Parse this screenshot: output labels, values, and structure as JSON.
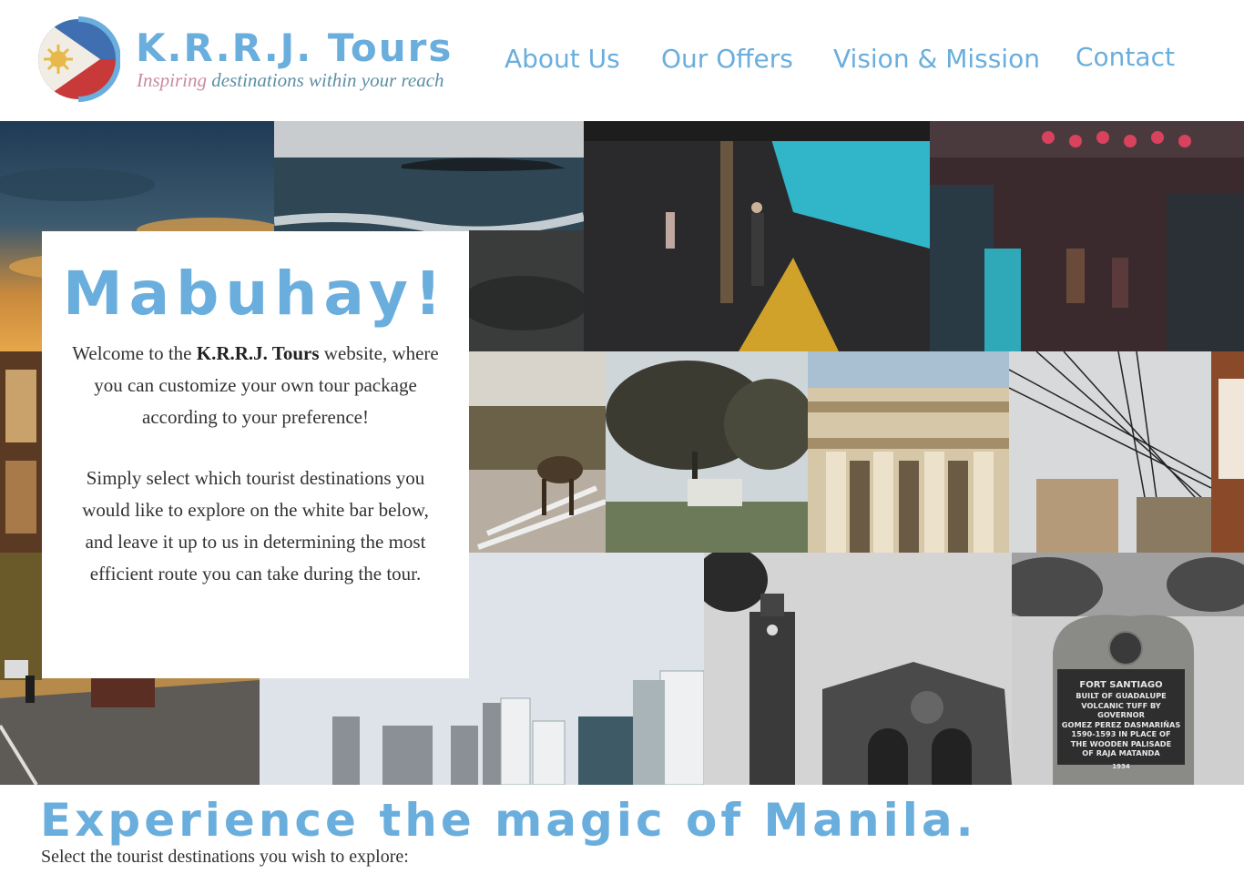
{
  "brand": {
    "name": "K.R.R.J. Tours",
    "tagline_accent": "Inspiring",
    "tagline_rest": "destinations within your reach"
  },
  "nav": {
    "about": "About Us",
    "offers": "Our Offers",
    "vision": "Vision & Mission",
    "contact": "Contact"
  },
  "welcome": {
    "title": "Mabuhay!",
    "p1_before": "Welcome to the ",
    "p1_brand": "K.R.R.J. Tours",
    "p1_after": " website, where you can customize your own tour package  according to your preference!",
    "p2": "Simply select which tourist destinations you would like to explore on the white bar below, and leave it up to us in determining the most efficient route you can take during the tour."
  },
  "monument": {
    "line1": "FORT SANTIAGO",
    "line2": "BUILT OF GUADALUPE",
    "line3": "VOLCANIC TUFF BY GOVERNOR",
    "line4": "GOMEZ PEREZ DASMARIÑAS",
    "line5": "1590-1593 IN PLACE OF",
    "line6": "THE WOODEN PALISADE",
    "line7": "OF RAJA MATANDA",
    "year": "1934"
  },
  "experience": {
    "headline": "Experience the magic of Manila.",
    "instruction": "Select the tourist destinations you wish to explore:"
  },
  "colors": {
    "accent": "#6aaedd",
    "tagline_pink": "#c98a9d",
    "tagline_teal": "#5c8fa6"
  }
}
